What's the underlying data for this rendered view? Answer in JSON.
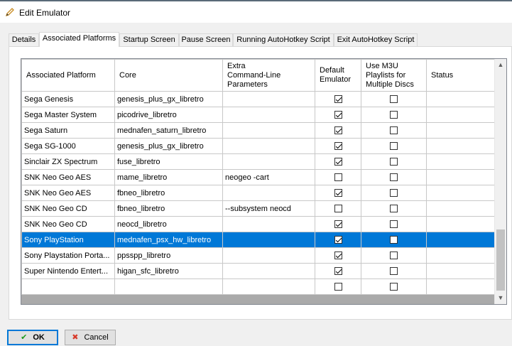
{
  "window": {
    "title": "Edit Emulator"
  },
  "tabs": [
    {
      "label": "Details",
      "active": false
    },
    {
      "label": "Associated Platforms",
      "active": true
    },
    {
      "label": "Startup Screen",
      "active": false
    },
    {
      "label": "Pause Screen",
      "active": false
    },
    {
      "label": "Running AutoHotkey Script",
      "active": false
    },
    {
      "label": "Exit AutoHotkey Script",
      "active": false
    }
  ],
  "grid": {
    "columns": [
      "Associated Platform",
      "Core",
      "Extra\nCommand-Line\nParameters",
      "Default\nEmulator",
      "Use M3U\nPlaylists for\nMultiple Discs",
      "Status"
    ],
    "rows": [
      {
        "platform": "Sega Genesis",
        "core": "genesis_plus_gx_libretro",
        "params": "",
        "default": true,
        "m3u": false,
        "status": ""
      },
      {
        "platform": "Sega Master System",
        "core": "picodrive_libretro",
        "params": "",
        "default": true,
        "m3u": false,
        "status": ""
      },
      {
        "platform": "Sega Saturn",
        "core": "mednafen_saturn_libretro",
        "params": "",
        "default": true,
        "m3u": false,
        "status": ""
      },
      {
        "platform": "Sega SG-1000",
        "core": "genesis_plus_gx_libretro",
        "params": "",
        "default": true,
        "m3u": false,
        "status": ""
      },
      {
        "platform": "Sinclair ZX Spectrum",
        "core": "fuse_libretro",
        "params": "",
        "default": true,
        "m3u": false,
        "status": ""
      },
      {
        "platform": "SNK Neo Geo AES",
        "core": "mame_libretro",
        "params": "neogeo -cart",
        "default": false,
        "m3u": false,
        "status": ""
      },
      {
        "platform": "SNK Neo Geo AES",
        "core": "fbneo_libretro",
        "params": "",
        "default": true,
        "m3u": false,
        "status": ""
      },
      {
        "platform": "SNK Neo Geo CD",
        "core": "fbneo_libretro",
        "params": "--subsystem neocd",
        "default": false,
        "m3u": false,
        "status": ""
      },
      {
        "platform": "SNK Neo Geo CD",
        "core": "neocd_libretro",
        "params": "",
        "default": true,
        "m3u": false,
        "status": ""
      },
      {
        "platform": "Sony PlayStation",
        "core": "mednafen_psx_hw_libretro",
        "params": "",
        "default": true,
        "m3u": false,
        "status": "",
        "selected": true
      },
      {
        "platform": "Sony Playstation Porta...",
        "core": "ppsspp_libretro",
        "params": "",
        "default": true,
        "m3u": false,
        "status": ""
      },
      {
        "platform": "Super Nintendo Entert...",
        "core": "higan_sfc_libretro",
        "params": "",
        "default": true,
        "m3u": false,
        "status": ""
      },
      {
        "platform": "",
        "core": "",
        "params": "",
        "default": false,
        "m3u": false,
        "status": ""
      }
    ]
  },
  "buttons": {
    "ok": "OK",
    "cancel": "Cancel"
  },
  "colors": {
    "selection": "#0078d7",
    "ok_check": "#1a9a1a",
    "cancel_x": "#d83a2a",
    "pencil": "#c88a1e"
  },
  "icons": {
    "title": "pencil-icon",
    "ok": "check-icon",
    "cancel": "x-icon"
  }
}
